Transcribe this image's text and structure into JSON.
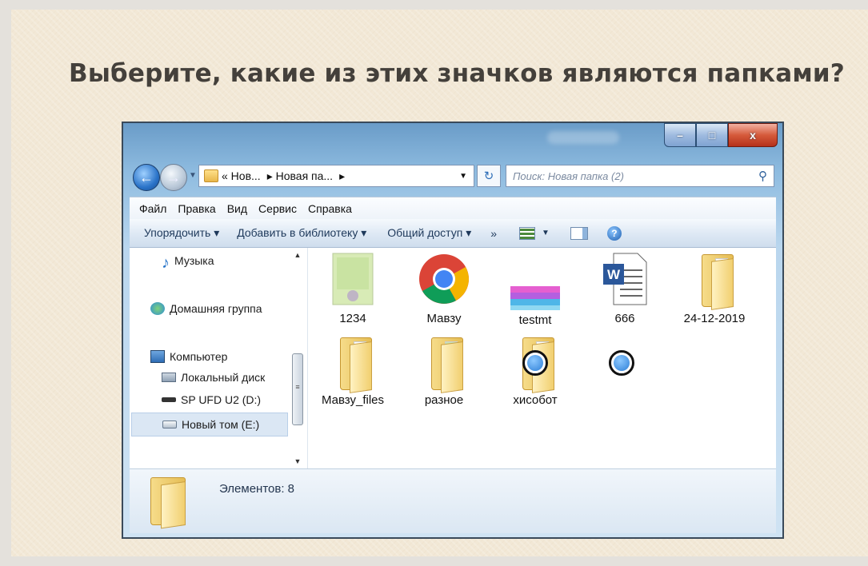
{
  "slide": {
    "title": "Выберите, какие из этих значков являются папками?"
  },
  "window": {
    "controls": {
      "minimize": "–",
      "maximize": "□",
      "close": "x"
    }
  },
  "address_bar": {
    "crumbs": [
      "« Нов...",
      "▸ Новая па...",
      "▸"
    ],
    "refresh_glyph": "↻",
    "search_placeholder": "Поиск: Новая папка (2)",
    "search_glyph": "⚲"
  },
  "menu": {
    "items": [
      "Файл",
      "Правка",
      "Вид",
      "Сервис",
      "Справка"
    ]
  },
  "toolbar": {
    "organize": "Упорядочить ▾",
    "add_to_library": "Добавить в библиотеку ▾",
    "share": "Общий доступ ▾",
    "more": "»",
    "help": "?"
  },
  "nav_pane": {
    "items": [
      {
        "label": "Музыка",
        "icon": "music-icon"
      },
      {
        "label": "Домашняя группа",
        "icon": "homegroup-icon"
      },
      {
        "label": "Компьютер",
        "icon": "computer-icon"
      },
      {
        "label": "Локальный диск",
        "icon": "local-disk-icon"
      },
      {
        "label": "SP UFD U2 (D:)",
        "icon": "usb-drive-icon"
      },
      {
        "label": "Новый том (E:)",
        "icon": "drive-icon",
        "selected": true
      }
    ],
    "scroll_up": "▲",
    "scroll_down": "▼",
    "scroll_grip": "≡"
  },
  "files": [
    {
      "name": "1234",
      "type": "image-file"
    },
    {
      "name": "Мавзу",
      "type": "chrome-html-file"
    },
    {
      "name": "testmt",
      "type": "bitmap-file"
    },
    {
      "name": "666",
      "type": "word-document"
    },
    {
      "name": "24-12-2019",
      "type": "folder"
    },
    {
      "name": "Мавзу_files",
      "type": "folder"
    },
    {
      "name": "разное",
      "type": "folder"
    },
    {
      "name": "хисобот",
      "type": "folder",
      "answer_marked": true
    }
  ],
  "status_bar": {
    "count": "Элементов: 8"
  },
  "colors": {
    "answer_marker": "#2d7fd6",
    "folder": "#f1cf6f"
  }
}
